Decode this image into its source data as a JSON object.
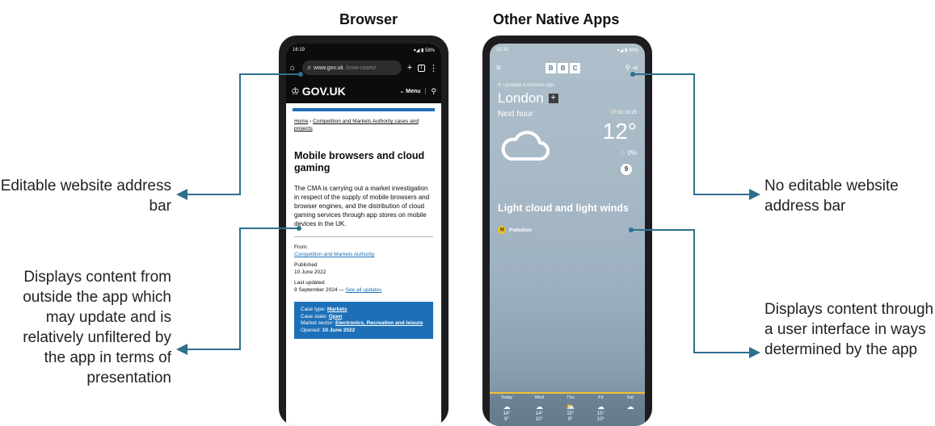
{
  "headings": {
    "browser": "Browser",
    "native": "Other Native Apps"
  },
  "annotations": {
    "editable": "Editable website address bar",
    "content_outside": "Displays content from outside the app which may update and is relatively unfiltered by the app in terms of presentation",
    "no_editable": "No editable website address bar",
    "content_ui": "Displays content through a user interface in ways determined by the app"
  },
  "browser_phone": {
    "status_time": "16:19",
    "status_battery": "58%",
    "url_host": "www.gov.uk",
    "url_path": "/cma-cases/",
    "site_name": "GOV.UK",
    "menu_label": "Menu",
    "breadcrumb_home": "Home",
    "breadcrumb_section": "Competition and Markets Authority cases and projects",
    "page_title": "Mobile browsers and cloud gaming",
    "description": "The CMA is carrying out a market investigation in respect of the supply of mobile browsers and browser engines, and the distribution of cloud gaming services through app stores on mobile devices in the UK.",
    "from_label": "From:",
    "from_value": "Competition and Markets Authority",
    "published_label": "Published",
    "published_value": "10 June 2022",
    "updated_label": "Last updated",
    "updated_value": "9 September 2024 —",
    "see_updates": "See all updates",
    "case_type_label": "Case type:",
    "case_type_value": "Markets",
    "case_state_label": "Case state:",
    "case_state_value": "Open",
    "market_sector_label": "Market sector:",
    "market_sector_value": "Electronics, Recreation and leisure",
    "opened_label": "Opened:",
    "opened_value": "10 June 2022"
  },
  "native_phone": {
    "status_time": "10:19",
    "status_battery": "90%",
    "logo_letters": [
      "B",
      "B",
      "C"
    ],
    "updated_text": "Updated a moment ago",
    "city": "London",
    "next_hour": "Next hour",
    "sun_times": "07:02  16:25",
    "temperature": "12°",
    "precip": "0%",
    "wind": "9",
    "condition": "Light cloud and light winds",
    "pollution_badge": "M",
    "pollution_label": "Pollution",
    "forecast": [
      {
        "day": "Today",
        "high": "14°",
        "low": "9°",
        "icon": "cloud-icon"
      },
      {
        "day": "Wed",
        "high": "14°",
        "low": "10°",
        "icon": "cloud-icon"
      },
      {
        "day": "Thu",
        "high": "15°",
        "low": "9°",
        "icon": "sun-cloud-icon"
      },
      {
        "day": "Fri",
        "high": "15°",
        "low": "10°",
        "icon": "cloud-icon"
      },
      {
        "day": "Sat",
        "high": "",
        "low": "",
        "icon": "cloud-icon"
      }
    ]
  },
  "colors": {
    "connector": "#2e6f8e",
    "govuk_black": "#0b0c0c",
    "govuk_blue": "#1d70b8",
    "forecast_accent": "#f1c232"
  }
}
